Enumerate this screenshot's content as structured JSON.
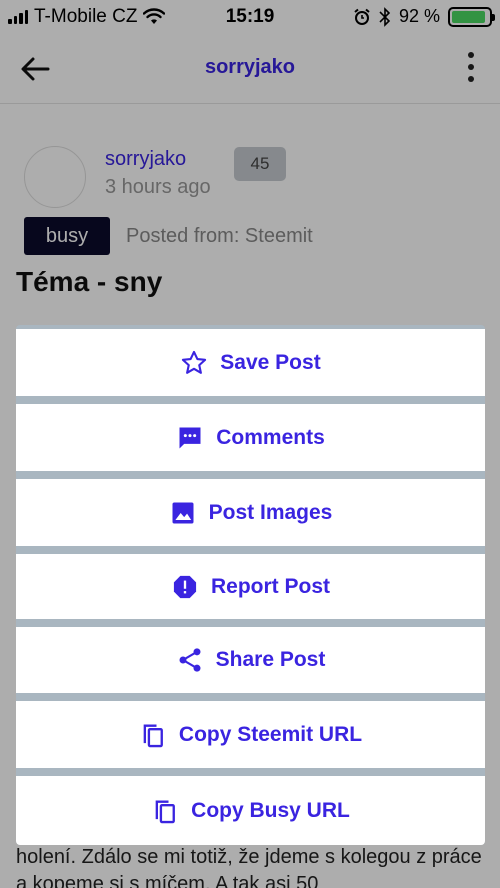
{
  "status_bar": {
    "carrier": "T-Mobile CZ",
    "time": "15:19",
    "battery": "92 %",
    "battery_level": 0.92
  },
  "header": {
    "title": "sorryjako"
  },
  "post": {
    "author": "sorryjako",
    "time_ago": "3 hours ago",
    "reputation": "45",
    "tag": "busy",
    "posted_from": "Posted from: Steemit",
    "title": "Téma - sny",
    "body_visible": "holení. Zdálo se mi totiž, že jdeme s kolegou z práce a kopeme si s míčem. A tak asi 50"
  },
  "actions": [
    {
      "label": "Save Post",
      "icon": "star-outline-icon"
    },
    {
      "label": "Comments",
      "icon": "comment-icon"
    },
    {
      "label": "Post Images",
      "icon": "image-icon"
    },
    {
      "label": "Report Post",
      "icon": "report-icon"
    },
    {
      "label": "Share Post",
      "icon": "share-icon"
    },
    {
      "label": "Copy Steemit URL",
      "icon": "copy-icon"
    },
    {
      "label": "Copy Busy URL",
      "icon": "copy-icon"
    }
  ],
  "colors": {
    "accent": "#3a24e0",
    "tag_bg": "#0b0b2b",
    "sheet_divider": "#a9b6c0"
  }
}
